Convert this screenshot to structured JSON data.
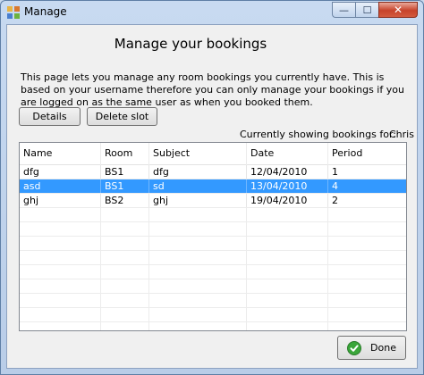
{
  "window": {
    "title": "Manage",
    "close_glyph": "✕",
    "minimize_glyph": "—",
    "maximize_glyph": "☐"
  },
  "heading": "Manage your bookings",
  "description": "This page lets you manage any room bookings you currently have. This is based on your username therefore you can only manage your bookings if you are logged on as the same user as when you booked them.",
  "toolbar": {
    "details_label": "Details",
    "delete_label": "Delete slot"
  },
  "showing": {
    "label": "Currently showing bookings for:",
    "user": "Chris"
  },
  "table": {
    "columns": [
      "Name",
      "Room",
      "Subject",
      "Date",
      "Period"
    ],
    "rows": [
      [
        "dfg",
        "BS1",
        "dfg",
        "12/04/2010",
        "1"
      ],
      [
        "asd",
        "BS1",
        "sd",
        "13/04/2010",
        "4"
      ],
      [
        "ghj",
        "BS2",
        "ghj",
        "19/04/2010",
        "2"
      ]
    ],
    "selected_row": 1
  },
  "footer": {
    "done_label": "Done",
    "done_icon": "check-icon"
  },
  "colors": {
    "selection": "#3399ff",
    "done_check": "#3aa63a",
    "close_button": "#c7422a"
  }
}
